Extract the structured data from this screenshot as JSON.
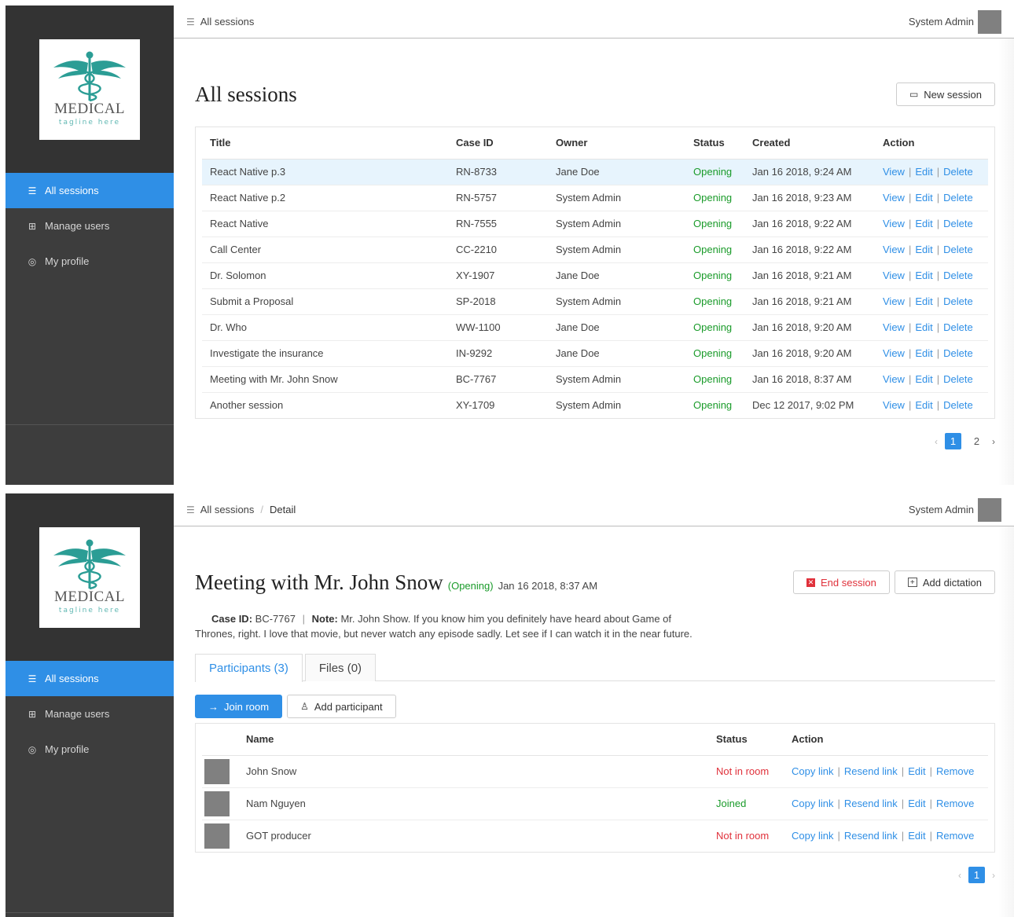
{
  "logo": {
    "word": "MEDICAL",
    "tagline": "tagline here"
  },
  "nav": [
    {
      "label": "All sessions",
      "icon": "list-icon"
    },
    {
      "label": "Manage users",
      "icon": "users-icon"
    },
    {
      "label": "My profile",
      "icon": "profile-icon"
    }
  ],
  "user": {
    "name": "System Admin"
  },
  "list_page": {
    "breadcrumb": "All sessions",
    "title": "All sessions",
    "new_session_label": "New session",
    "columns": [
      "Title",
      "Case ID",
      "Owner",
      "Status",
      "Created",
      "Action"
    ],
    "rows": [
      {
        "title": "React Native p.3",
        "case_id": "RN-8733",
        "owner": "Jane Doe",
        "status": "Opening",
        "created": "Jan 16 2018, 9:24 AM"
      },
      {
        "title": "React Native p.2",
        "case_id": "RN-5757",
        "owner": "System Admin",
        "status": "Opening",
        "created": "Jan 16 2018, 9:23 AM"
      },
      {
        "title": "React Native",
        "case_id": "RN-7555",
        "owner": "System Admin",
        "status": "Opening",
        "created": "Jan 16 2018, 9:22 AM"
      },
      {
        "title": "Call Center",
        "case_id": "CC-2210",
        "owner": "System Admin",
        "status": "Opening",
        "created": "Jan 16 2018, 9:22 AM"
      },
      {
        "title": "Dr. Solomon",
        "case_id": "XY-1907",
        "owner": "Jane Doe",
        "status": "Opening",
        "created": "Jan 16 2018, 9:21 AM"
      },
      {
        "title": "Submit a Proposal",
        "case_id": "SP-2018",
        "owner": "System Admin",
        "status": "Opening",
        "created": "Jan 16 2018, 9:21 AM"
      },
      {
        "title": "Dr. Who",
        "case_id": "WW-1100",
        "owner": "Jane Doe",
        "status": "Opening",
        "created": "Jan 16 2018, 9:20 AM"
      },
      {
        "title": "Investigate the insurance",
        "case_id": "IN-9292",
        "owner": "Jane Doe",
        "status": "Opening",
        "created": "Jan 16 2018, 9:20 AM"
      },
      {
        "title": "Meeting with Mr. John Snow",
        "case_id": "BC-7767",
        "owner": "System Admin",
        "status": "Opening",
        "created": "Jan 16 2018, 8:37 AM"
      },
      {
        "title": "Another session",
        "case_id": "XY-1709",
        "owner": "System Admin",
        "status": "Opening",
        "created": "Dec 12 2017, 9:02 PM"
      }
    ],
    "action_links": [
      "View",
      "Edit",
      "Delete"
    ],
    "pagination": {
      "pages": [
        "1",
        "2"
      ],
      "current": "1",
      "prev": "‹",
      "next": "›"
    }
  },
  "detail_page": {
    "breadcrumb": [
      "All sessions",
      "Detail"
    ],
    "title": "Meeting with Mr. John Snow",
    "status": "(Opening)",
    "date": "Jan 16 2018, 8:37 AM",
    "end_session_label": "End session",
    "add_dictation_label": "Add dictation",
    "case_label": "Case ID:",
    "case_id": "BC-7767",
    "note_label": "Note:",
    "note": "Mr. John Show. If you know him you definitely have heard about Game of Thrones, right. I love that movie, but never watch any episode sadly. Let see if I can watch it in the near future.",
    "tabs": [
      "Participants (3)",
      "Files (0)"
    ],
    "join_room_label": "Join room",
    "add_participant_label": "Add participant",
    "columns": [
      "Name",
      "Status",
      "Action"
    ],
    "participants": [
      {
        "name": "John Snow",
        "status": "Not in room"
      },
      {
        "name": "Nam Nguyen",
        "status": "Joined"
      },
      {
        "name": "GOT producer",
        "status": "Not in room"
      }
    ],
    "action_links": [
      "Copy link",
      "Resend link",
      "Edit",
      "Remove"
    ],
    "pagination": {
      "pages": [
        "1"
      ],
      "current": "1",
      "prev": "‹",
      "next": "›"
    }
  },
  "colors": {
    "accent": "#2f8fe6",
    "sidebar": "#3d3d3d",
    "success": "#1a9b2a",
    "danger": "#e0313b",
    "logo_teal": "#2b9d95"
  }
}
